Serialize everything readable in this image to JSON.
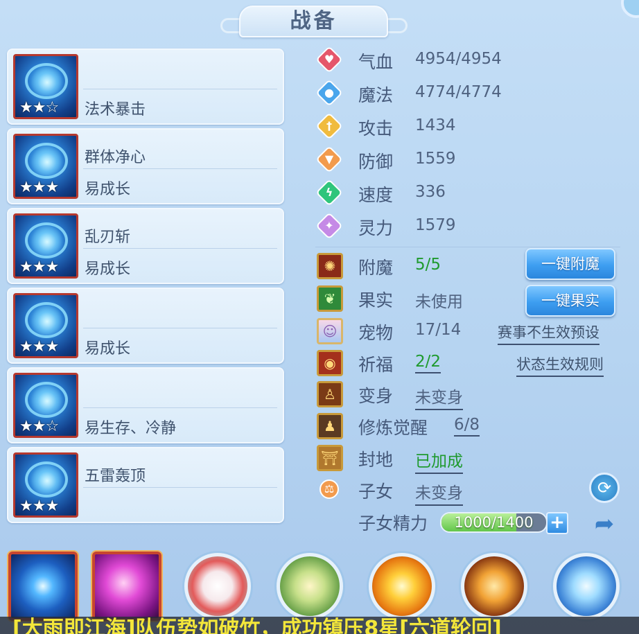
{
  "header": {
    "title": "战备"
  },
  "skills": [
    {
      "name": "",
      "tag": "法术暴击",
      "stars": "★★☆",
      "icon": "arrow-burst-icon"
    },
    {
      "name": "群体净心",
      "tag": "易成长",
      "stars": "★★★",
      "icon": "crystal-crown-icon"
    },
    {
      "name": "乱刃斩",
      "tag": "易成长",
      "stars": "★★★",
      "icon": "blade-mask-icon"
    },
    {
      "name": "",
      "tag": "易成长",
      "stars": "★★★",
      "icon": "spirit-dragon-icon"
    },
    {
      "name": "",
      "tag": "易生存、冷静",
      "stars": "★★☆",
      "icon": "shield-helm-icon"
    },
    {
      "name": "五雷轰顶",
      "tag": "",
      "stars": "★★★",
      "icon": "thunder-gem-icon"
    }
  ],
  "stats": [
    {
      "label": "气血",
      "value": "4954/4954",
      "icon": "heart-icon",
      "color": "#e5566b"
    },
    {
      "label": "魔法",
      "value": "4774/4774",
      "icon": "mana-orb-icon",
      "color": "#4aa6ec"
    },
    {
      "label": "攻击",
      "value": "1434",
      "icon": "sword-icon",
      "color": "#f0bb3e"
    },
    {
      "label": "防御",
      "value": "1559",
      "icon": "shield-icon",
      "color": "#f29b4d"
    },
    {
      "label": "速度",
      "value": "336",
      "icon": "lightning-icon",
      "color": "#2fc57b"
    },
    {
      "label": "灵力",
      "value": "1579",
      "icon": "spirit-star-icon",
      "color": "#c58ae6"
    }
  ],
  "extras": {
    "enchant": {
      "label": "附魔",
      "value": "5/5",
      "button": "一键附魔"
    },
    "fruit": {
      "label": "果实",
      "value": "未使用",
      "button": "一键果实"
    },
    "pet": {
      "label": "宠物",
      "value": "17/14",
      "link": "赛事不生效预设"
    },
    "blessing": {
      "label": "祈福",
      "value": "2/2",
      "link": "状态生效规则"
    },
    "transform": {
      "label": "变身",
      "value": "未变身"
    },
    "cultivation": {
      "label": "修炼觉醒",
      "value": "6/8"
    },
    "fief": {
      "label": "封地",
      "value": "已加成"
    },
    "children": {
      "label": "子女",
      "value": "未变身"
    },
    "child_energy": {
      "label": "子女精力",
      "value": "1000/1400",
      "current": 1000,
      "max": 1400
    }
  },
  "bottom_skills": [
    {
      "icon": "blue-star-burst-icon"
    },
    {
      "icon": "purple-palm-icon"
    },
    {
      "icon": "red-swirl-icon"
    },
    {
      "icon": "golden-warrior-icon"
    },
    {
      "icon": "fire-orb-icon"
    },
    {
      "icon": "flame-claw-icon"
    },
    {
      "icon": "ice-dragon-icon"
    }
  ],
  "marquee": {
    "text": "[大雨即江海]队伍势如破竹，成功镇压8星[六道轮回]"
  }
}
